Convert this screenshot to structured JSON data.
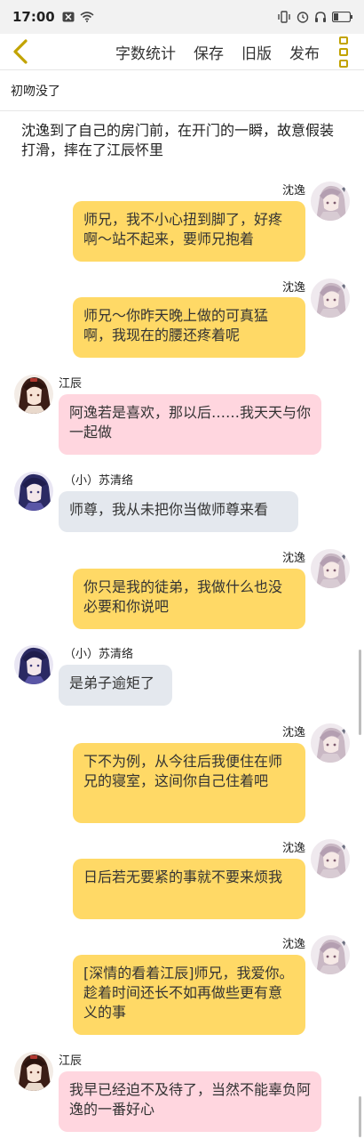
{
  "status_bar": {
    "time": "17:00",
    "left_icons": [
      "close-box-icon",
      "wifi-icon"
    ],
    "right_icons": [
      "vibrate-icon",
      "alarm-icon",
      "headphones-icon",
      "battery-icon"
    ]
  },
  "toolbar": {
    "back_icon": "chevron-left-icon",
    "actions": [
      "字数统计",
      "保存",
      "旧版",
      "发布"
    ],
    "more_icon": "more-vertical-icon"
  },
  "chapter_title": "初吻没了",
  "narration": "沈逸到了自己的房门前，在开门的一瞬，故意假装打滑，摔在了江辰怀里",
  "colors": {
    "accent": "#c2a300",
    "bubble_yellow": "#ffd966",
    "bubble_pink": "#ffd6df",
    "bubble_gray": "#e4e8ee"
  },
  "messages": [
    {
      "speaker": "沈逸",
      "side": "right",
      "text": "师兄，我不小心扭到脚了，好疼啊～站不起来，要师兄抱着"
    },
    {
      "speaker": "沈逸",
      "side": "right",
      "text": "师兄～你昨天晚上做的可真猛啊，我现在的腰还疼着呢"
    },
    {
      "speaker": "江辰",
      "side": "left",
      "text": "阿逸若是喜欢，那以后……我天天与你一起做"
    },
    {
      "speaker": "（小）苏清络",
      "side": "left",
      "text": "师尊，我从未把你当做师尊来看"
    },
    {
      "speaker": "沈逸",
      "side": "right",
      "text": "你只是我的徒弟，我做什么也没必要和你说吧"
    },
    {
      "speaker": "（小）苏清络",
      "side": "left",
      "text": "是弟子逾矩了"
    },
    {
      "speaker": "沈逸",
      "side": "right",
      "text": "下不为例，从今往后我便住在师兄的寝室，这间你自己住着吧"
    },
    {
      "speaker": "沈逸",
      "side": "right",
      "text": "日后若无要紧的事就不要来烦我"
    },
    {
      "speaker": "沈逸",
      "side": "right",
      "text": "[深情的看着江辰]师兄，我爱你。趁着时间还长不如再做些更有意义的事"
    },
    {
      "speaker": "江辰",
      "side": "left",
      "text": "我早已经迫不及待了，当然不能辜负阿逸的一番好心"
    }
  ]
}
